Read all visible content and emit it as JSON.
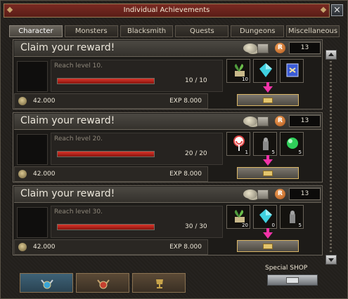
{
  "window": {
    "title": "Individual Achievements",
    "close_glyph": "×"
  },
  "tabs": [
    {
      "label": "Character",
      "active": true
    },
    {
      "label": "Monsters",
      "active": false
    },
    {
      "label": "Blacksmith",
      "active": false
    },
    {
      "label": "Quests",
      "active": false
    },
    {
      "label": "Dungeons",
      "active": false
    },
    {
      "label": "Miscellaneous",
      "active": false
    }
  ],
  "achievements": [
    {
      "title": "Claim your reward!",
      "r_badge": "R",
      "r_points": "13",
      "requirement": "Reach level 10.",
      "progress_text": "10 / 10",
      "progress_fraction": 1.0,
      "gold": "42.000",
      "exp": "EXP 8.000",
      "rewards": [
        {
          "icon": "herb-plant-icon",
          "qty": "10",
          "color": "#4e9a3c"
        },
        {
          "icon": "crystal-gem-icon",
          "qty": "",
          "color": "#3fd0e0"
        },
        {
          "icon": "scroll-card-icon",
          "qty": "",
          "color": "#3b5bd6"
        }
      ]
    },
    {
      "title": "Claim your reward!",
      "r_badge": "R",
      "r_points": "13",
      "requirement": "Reach level 20.",
      "progress_text": "20 / 20",
      "progress_fraction": 1.0,
      "gold": "42.000",
      "exp": "EXP 8.000",
      "rewards": [
        {
          "icon": "lollipop-icon",
          "qty": "1",
          "color": "#e24848"
        },
        {
          "icon": "stone-statue-icon",
          "qty": "5",
          "color": "#8a8a8a"
        },
        {
          "icon": "green-orb-icon",
          "qty": "5",
          "color": "#2fcf5a"
        }
      ]
    },
    {
      "title": "Claim your reward!",
      "r_badge": "R",
      "r_points": "13",
      "requirement": "Reach level 30.",
      "progress_text": "30 / 30",
      "progress_fraction": 1.0,
      "gold": "42.000",
      "exp": "EXP 8.000",
      "rewards": [
        {
          "icon": "herb-plant-icon",
          "qty": "20",
          "color": "#4e9a3c"
        },
        {
          "icon": "crystal-gem-icon",
          "qty": "0",
          "color": "#3fd0e0"
        },
        {
          "icon": "stone-statue-icon",
          "qty": "5",
          "color": "#8a8a8a"
        }
      ]
    }
  ],
  "bottom": {
    "special_shop_label": "Special SHOP",
    "medal_tabs": [
      {
        "icon": "blue-medal-icon",
        "color": "#3aa5d6"
      },
      {
        "icon": "red-medal-icon",
        "color": "#c6402f"
      },
      {
        "icon": "gold-trophy-icon",
        "color": "#c8a44a"
      }
    ]
  }
}
